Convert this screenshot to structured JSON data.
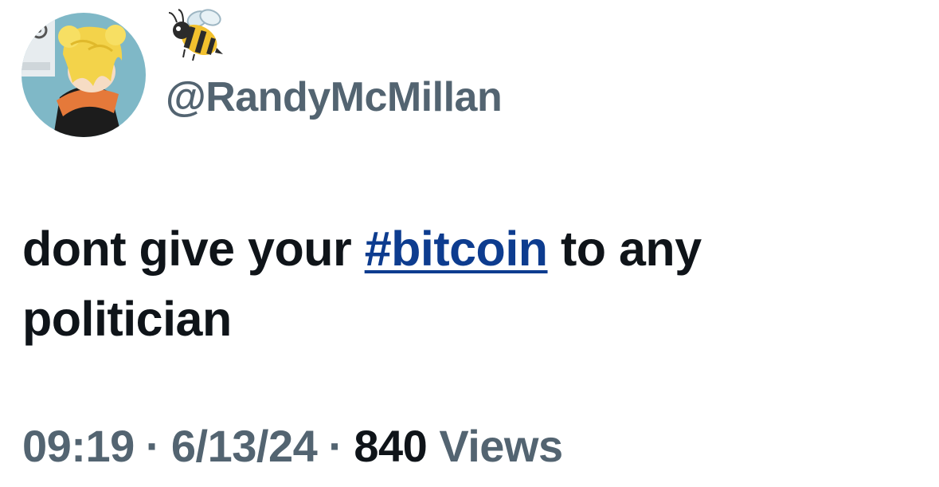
{
  "author": {
    "display_name_emoji": "bee-emoji",
    "handle": "@RandyMcMillan"
  },
  "tweet": {
    "text_part1": "dont give your ",
    "hashtag": "#bitcoin",
    "text_part2": " to any politician"
  },
  "meta": {
    "time": "09:19",
    "separator": "·",
    "date": "6/13/24",
    "views_count": "840",
    "views_label": "Views"
  },
  "colors": {
    "text_primary": "#0f1419",
    "text_secondary": "#536471",
    "hashtag": "#0d3c8f",
    "avatar_bg": "#7fb8c7"
  }
}
